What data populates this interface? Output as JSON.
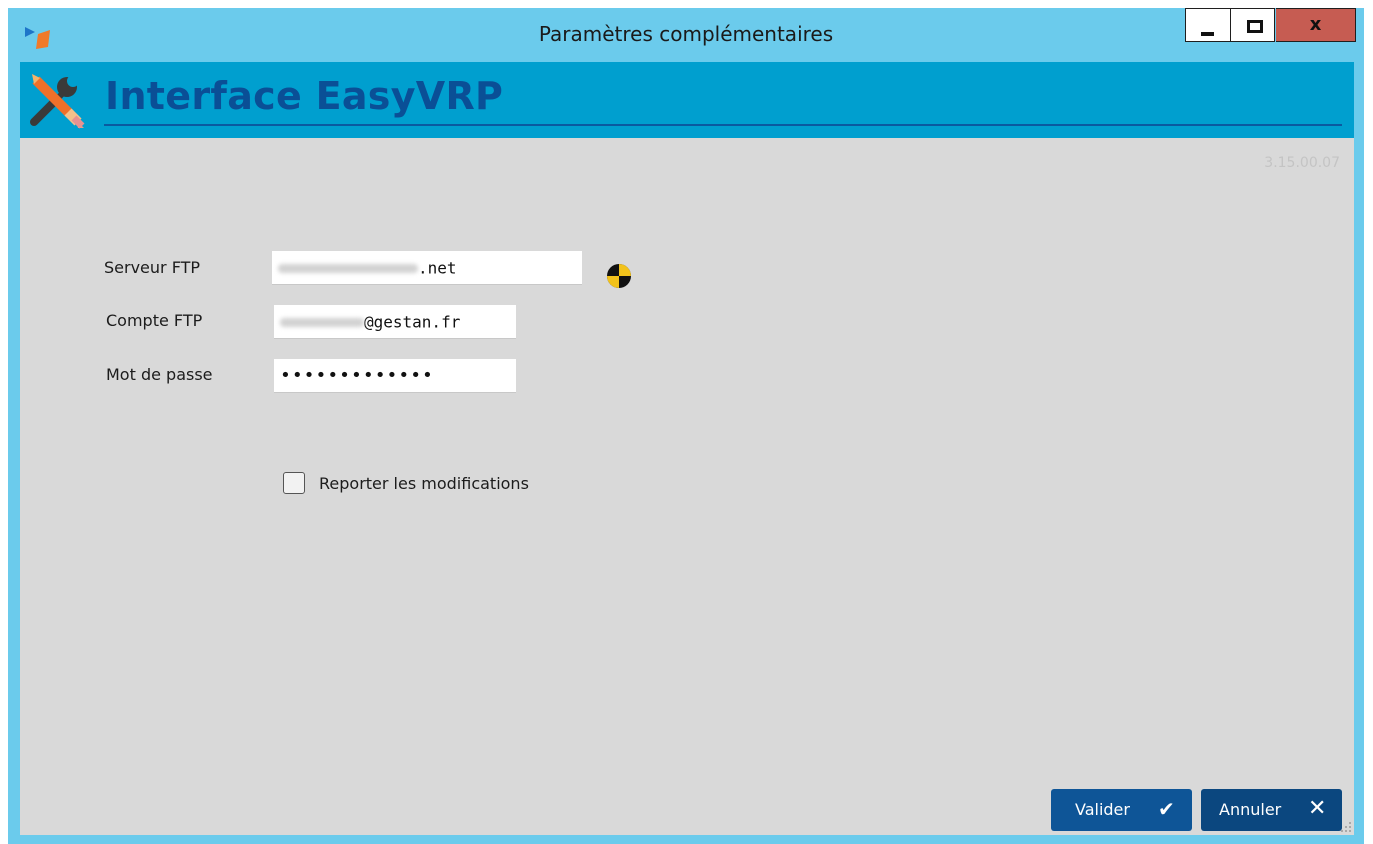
{
  "window": {
    "title": "Paramètres complémentaires",
    "controls": {
      "minimize": "minimize-icon",
      "maximize": "maximize-icon",
      "close": "x"
    }
  },
  "header": {
    "title": "Interface EasyVRP",
    "icon": "tools-icon"
  },
  "version": "3.15.00.07",
  "form": {
    "server": {
      "label": "Serveur FTP",
      "value_suffix": ".net",
      "status_icon": "status-indicator-icon"
    },
    "account": {
      "label": "Compte FTP",
      "value_suffix": "@gestan.fr"
    },
    "password": {
      "label": "Mot de passe",
      "value": "•••••••••••••"
    },
    "report_changes": {
      "label": "Reporter les modifications",
      "checked": false
    }
  },
  "buttons": {
    "ok": {
      "label": "Valider",
      "icon": "✔"
    },
    "cancel": {
      "label": "Annuler",
      "icon": "✕"
    }
  },
  "colors": {
    "window_frame": "#6bcbec",
    "header_band": "#009fcf",
    "header_title": "#0a4f96",
    "content_bg": "#d9d9d9",
    "button_bg": "#0e5597",
    "close_button": "#c65c52"
  }
}
